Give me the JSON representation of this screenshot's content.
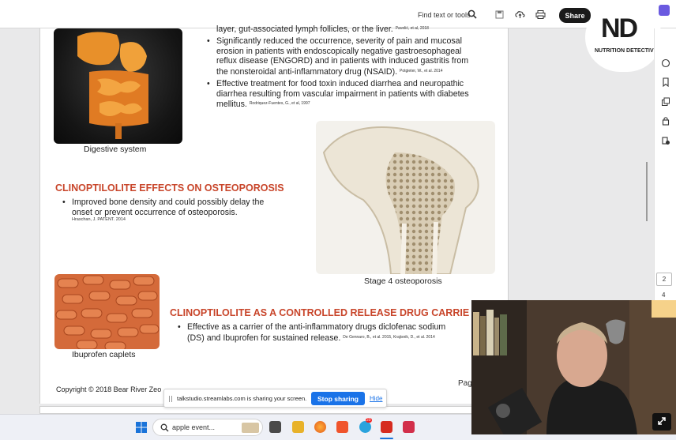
{
  "toolbar": {
    "find_label": "Find text or tools",
    "share_label": "Share"
  },
  "logo": {
    "mark": "ND",
    "subtitle": "NUTRITION DETECTIVE"
  },
  "sidebar": {
    "page_input": "2",
    "page_next": "4"
  },
  "document": {
    "top_partial": "layer, gut-associated lymph follicles, or the liver.",
    "top_partial_cite": "Pavelić, et al, 2018",
    "bullets_top": [
      {
        "lines": [
          "Significantly reduced the occurrence, severity of pain and mucosal",
          "erosion in patients with endoscopically negative gastroesophageal",
          "reflux disease (ENGORD) and in patients with induced gastritis from",
          "the nonsteroidal anti-inflammatory drug (NSAID)."
        ],
        "cite": "Potgieter, W., et al. 2014"
      },
      {
        "lines": [
          "Effective treatment for food toxin induced diarrhea and neuropathic",
          "diarrhea resulting from vascular impairment in patients with diabetes",
          "mellitus."
        ],
        "cite": "Rodriquez-Fuentes, G., et al, 1997"
      }
    ],
    "caption_digestive": "Digestive system",
    "heading_osteo": "CLINOPTILOLITE EFFECTS ON OSTEOPOROSIS",
    "bullet_osteo": [
      "Improved bone density and could possibly delay the",
      "onset or prevent occurrence of osteoporosis."
    ],
    "cite_osteo": "Hraschan, J. PATENT. 2014",
    "caption_bone": "Stage 4 osteoporosis",
    "heading_drug": "CLINOPTILOLITE AS A CONTROLLED RELEASE DRUG CARRIE",
    "bullet_drug": [
      "Effective as a carrier of the anti-inflammatory drugs diclofenac sodium",
      "(DS) and Ibuprofen for sustained release."
    ],
    "cite_drug": "De Gennaro, B., et al. 2015, Krajisnik, D., et al. 2014",
    "caption_pills": "Ibuprofen caplets",
    "copyright": "Copyright © 2018 Bear River Zeo",
    "page_label": "Pag"
  },
  "share_bar": {
    "message": "talkstudio.streamlabs.com is sharing your screen.",
    "stop_label": "Stop sharing",
    "hide_label": "Hide"
  },
  "taskbar": {
    "search_text": "apple event...",
    "telegram_badge": "20"
  },
  "colors": {
    "heading": "#c8452a",
    "stop_button": "#1a73e8"
  }
}
